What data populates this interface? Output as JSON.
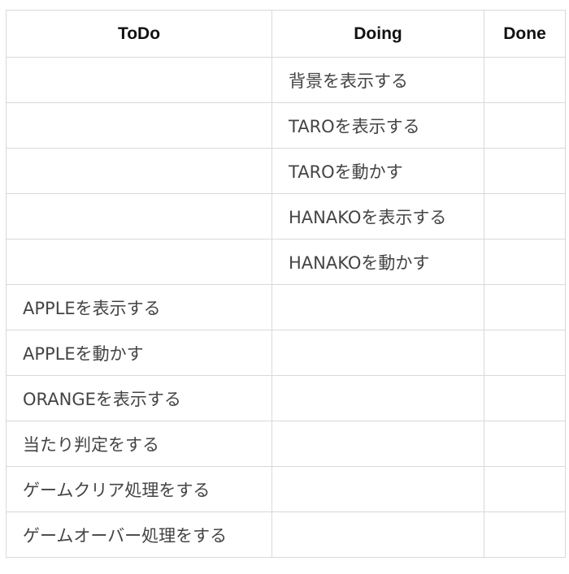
{
  "board": {
    "headers": {
      "todo": "ToDo",
      "doing": "Doing",
      "done": "Done"
    },
    "rows": [
      {
        "todo": "",
        "doing": "背景を表示する",
        "done": ""
      },
      {
        "todo": "",
        "doing": "TAROを表示する",
        "done": ""
      },
      {
        "todo": "",
        "doing": "TAROを動かす",
        "done": ""
      },
      {
        "todo": "",
        "doing": "HANAKOを表示する",
        "done": ""
      },
      {
        "todo": "",
        "doing": "HANAKOを動かす",
        "done": ""
      },
      {
        "todo": "APPLEを表示する",
        "doing": "",
        "done": ""
      },
      {
        "todo": "APPLEを動かす",
        "doing": "",
        "done": ""
      },
      {
        "todo": "ORANGEを表示する",
        "doing": "",
        "done": ""
      },
      {
        "todo": "当たり判定をする",
        "doing": "",
        "done": ""
      },
      {
        "todo": "ゲームクリア処理をする",
        "doing": "",
        "done": ""
      },
      {
        "todo": "ゲームオーバー処理をする",
        "doing": "",
        "done": ""
      }
    ]
  }
}
